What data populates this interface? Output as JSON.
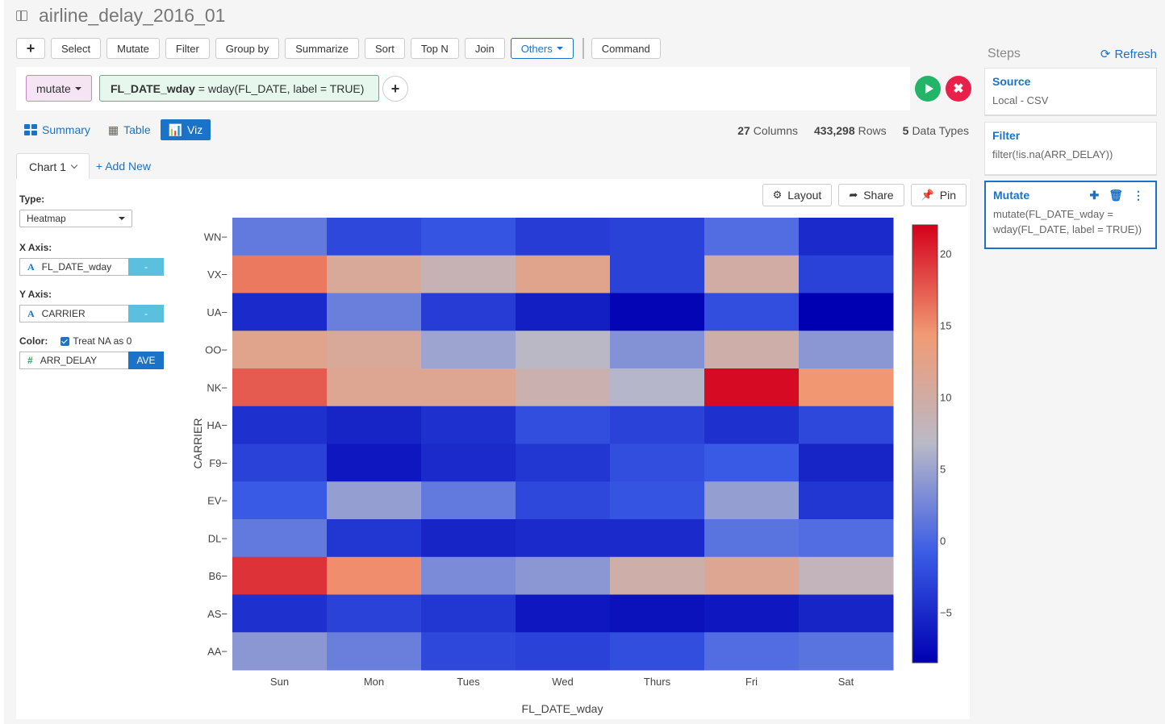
{
  "window": {
    "title": "airline_delay_2016_01"
  },
  "toolbar": {
    "add_label": "+",
    "buttons": [
      "Select",
      "Mutate",
      "Filter",
      "Group by",
      "Summarize",
      "Sort",
      "Top N",
      "Join"
    ],
    "others_label": "Others",
    "command_label": "Command"
  },
  "command": {
    "verb": "mutate",
    "expr_bold": "FL_DATE_wday",
    "expr_rest": "= wday(FL_DATE, label = TRUE)",
    "add_label": "+",
    "cancel_label": "✖"
  },
  "view_tabs": {
    "summary": "Summary",
    "table": "Table",
    "viz": "Viz"
  },
  "stats": {
    "columns_count": "27",
    "columns_label": "Columns",
    "rows_count": "433,298",
    "rows_label": "Rows",
    "types_count": "5",
    "types_label": "Data Types"
  },
  "chart_tabs": {
    "current": "Chart 1",
    "add_new": "+ Add New"
  },
  "chart_actions": {
    "layout": "Layout",
    "share": "Share",
    "pin": "Pin"
  },
  "form": {
    "type_label": "Type:",
    "type_value": "Heatmap",
    "x_label": "X Axis:",
    "x_value": "FL_DATE_wday",
    "x_btn": "-",
    "y_label": "Y Axis:",
    "y_value": "CARRIER",
    "y_btn": "-",
    "color_label": "Color:",
    "treat_na_label": "Treat NA as 0",
    "color_value": "ARR_DELAY",
    "color_btn": "AVE"
  },
  "steps": {
    "header": "Steps",
    "refresh": "Refresh",
    "items": [
      {
        "title": "Source",
        "desc": "Local - CSV"
      },
      {
        "title": "Filter",
        "desc": "filter(!is.na(ARR_DELAY))"
      },
      {
        "title": "Mutate",
        "desc": "mutate(FL_DATE_wday = wday(FL_DATE, label = TRUE))"
      }
    ]
  },
  "chart_data": {
    "type": "heatmap",
    "xlabel": "FL_DATE_wday",
    "ylabel": "CARRIER",
    "x": [
      "Sun",
      "Mon",
      "Tues",
      "Wed",
      "Thurs",
      "Fri",
      "Sat"
    ],
    "y": [
      "WN",
      "VX",
      "UA",
      "OO",
      "NK",
      "HA",
      "F9",
      "EV",
      "DL",
      "B6",
      "AS",
      "AA"
    ],
    "z": [
      [
        1.5,
        -2.5,
        -1.5,
        -3.5,
        -3.0,
        0.5,
        -5.0
      ],
      [
        16.0,
        11.0,
        8.5,
        12.0,
        -3.0,
        10.0,
        -3.0
      ],
      [
        -5.0,
        2.0,
        -3.5,
        -6.0,
        -8.0,
        -2.0,
        -8.5
      ],
      [
        12.0,
        11.0,
        5.0,
        7.0,
        3.5,
        9.5,
        4.0
      ],
      [
        17.5,
        11.5,
        11.5,
        9.0,
        6.5,
        21.5,
        14.5
      ],
      [
        -4.5,
        -5.5,
        -4.5,
        -2.0,
        -3.0,
        -4.5,
        -2.5
      ],
      [
        -3.0,
        -6.5,
        -5.0,
        -4.0,
        -2.0,
        -1.0,
        -5.5
      ],
      [
        -1.0,
        4.5,
        1.5,
        -2.5,
        -1.5,
        4.5,
        -4.0
      ],
      [
        1.5,
        -4.0,
        -5.5,
        -5.0,
        -5.0,
        1.0,
        0.5
      ],
      [
        19.5,
        15.0,
        3.0,
        4.0,
        9.5,
        11.5,
        8.0
      ],
      [
        -4.5,
        -3.0,
        -4.0,
        -6.5,
        -7.0,
        -6.5,
        -5.5
      ],
      [
        4.0,
        2.0,
        -2.5,
        -3.0,
        -2.0,
        0.5,
        1.0
      ]
    ],
    "colorbar": {
      "ticks": [
        20,
        15,
        10,
        5,
        0,
        -5
      ],
      "tick_labels": [
        "20",
        "15",
        "10",
        "5",
        "0",
        "−5"
      ],
      "min": -8.5,
      "max": 22
    },
    "colorscale": [
      "#0000b2",
      "#3a5ce6",
      "#b9b9c8",
      "#f19a73",
      "#d4001c"
    ]
  }
}
